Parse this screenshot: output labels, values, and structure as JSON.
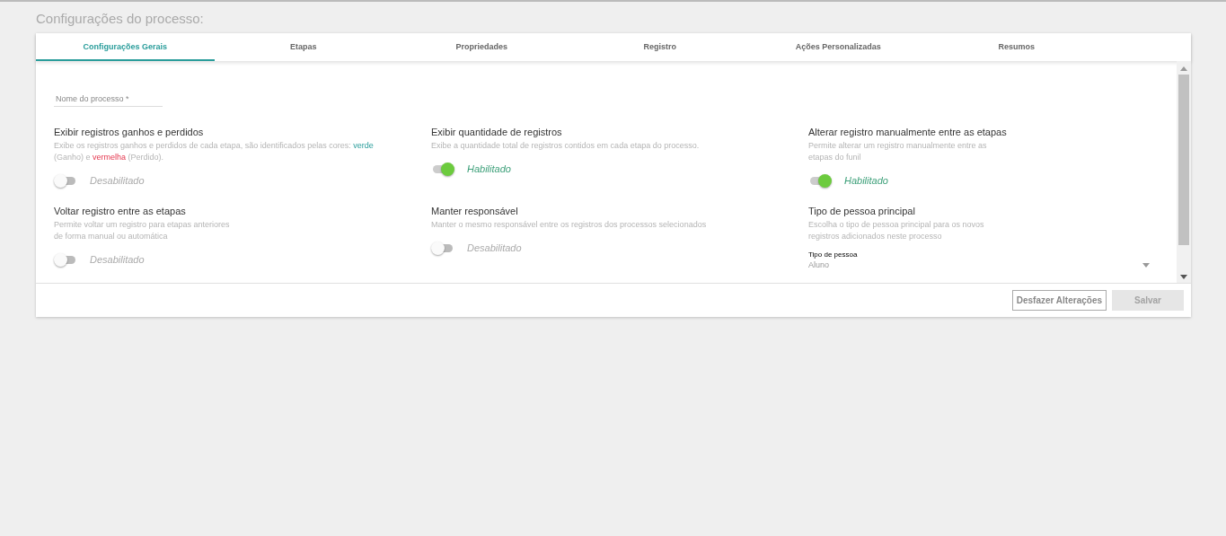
{
  "page_title": "Configurações do processo:",
  "tabs": [
    {
      "label": "Configurações Gerais",
      "selected": true
    },
    {
      "label": "Etapas",
      "selected": false
    },
    {
      "label": "Propriedades",
      "selected": false
    },
    {
      "label": "Registro",
      "selected": false
    },
    {
      "label": "Ações Personalizadas",
      "selected": false
    },
    {
      "label": "Resumos",
      "selected": false
    }
  ],
  "process_name_field": {
    "placeholder": "Nome do processo *"
  },
  "settings": [
    {
      "kind": "toggle",
      "title": "Exibir registros ganhos e perdidos",
      "description": [
        {
          "kind": "plain",
          "text": "Exibe os registros ganhos e perdidos de cada etapa, são identificados pelas cores: "
        },
        {
          "kind": "positive",
          "text": "verde"
        },
        {
          "kind": "plain",
          "text": " (Ganho) e "
        },
        {
          "kind": "negative",
          "text": "vermelha"
        },
        {
          "kind": "plain",
          "text": " (Perdido)."
        }
      ],
      "on": false,
      "status": "Desabilitado"
    },
    {
      "kind": "toggle",
      "title": "Exibir quantidade de registros",
      "description": [
        {
          "kind": "plain",
          "text": "Exibe a quantidade total de registros contidos em cada etapa do processo."
        }
      ],
      "on": true,
      "status": "Habilitado"
    },
    {
      "kind": "toggle",
      "title": "Alterar registro manualmente entre as etapas",
      "description": [
        {
          "kind": "plain",
          "text": "Permite alterar um registro manualmente entre as etapas do funil"
        }
      ],
      "on": true,
      "status": "Habilitado"
    },
    {
      "kind": "toggle",
      "title": "Voltar registro entre as etapas",
      "description": [
        {
          "kind": "plain",
          "text": "Permite voltar um registro para etapas anteriores de forma manual ou automática"
        }
      ],
      "on": false,
      "status": "Desabilitado"
    },
    {
      "kind": "toggle",
      "title": "Manter responsável",
      "description": [
        {
          "kind": "plain",
          "text": "Manter o mesmo responsável entre os registros dos processos selecionados"
        }
      ],
      "on": false,
      "status": "Desabilitado"
    },
    {
      "kind": "select",
      "title": "Tipo de pessoa principal",
      "description": [
        {
          "kind": "plain",
          "text": "Escolha o tipo de pessoa principal para os novos registros adicionados neste processo"
        }
      ],
      "field_label": "Tipo de pessoa",
      "value": "Aluno"
    }
  ],
  "buttons": [
    {
      "label": "Desfazer Alterações",
      "disabled": false
    },
    {
      "label": "Salvar",
      "disabled": true
    }
  ]
}
